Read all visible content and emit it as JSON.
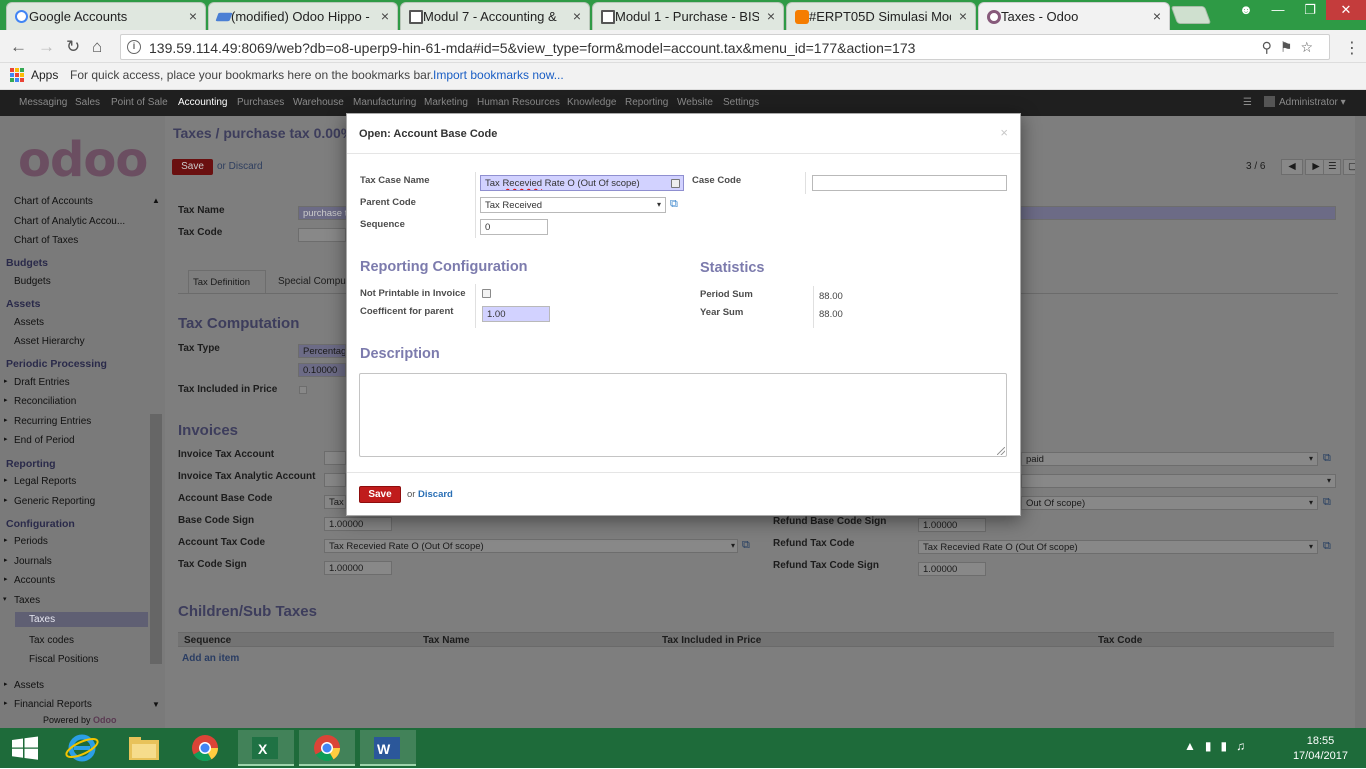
{
  "browser": {
    "tabs": [
      {
        "label": "Google Accounts",
        "favicon": "google-g-icon",
        "color": "#4285f4"
      },
      {
        "label": "(modified) Odoo Hippo -",
        "favicon": "layers-icon",
        "color": "#4a7fd4"
      },
      {
        "label": "Modul 7 - Accounting &",
        "favicon": "book-icon",
        "color": "#555555"
      },
      {
        "label": "Modul 1 - Purchase - BIS",
        "favicon": "book-icon",
        "color": "#555555"
      },
      {
        "label": "#ERPT05D Simulasi Mod",
        "favicon": "blogger-icon",
        "color": "#f57d00"
      },
      {
        "label": "Taxes - Odoo",
        "favicon": "odoo-circle-icon",
        "color": "#875a7b"
      }
    ],
    "tab_close": "×",
    "url": "139.59.114.49:8069/web?db=o8-uperp9-hin-61-mda#id=5&view_type=form&model=account.tax&menu_id=177&action=173",
    "bookmarks": {
      "apps_label": "Apps",
      "hint": "For quick access, place your bookmarks here on the bookmarks bar.",
      "import_link": "Import bookmarks now..."
    }
  },
  "topmenu": {
    "items": [
      "Messaging",
      "Sales",
      "Point of Sale",
      "Accounting",
      "Purchases",
      "Warehouse",
      "Manufacturing",
      "Marketing",
      "Human Resources",
      "Knowledge",
      "Reporting",
      "Website",
      "Settings"
    ],
    "active": "Accounting",
    "user": "Administrator"
  },
  "sidebar": {
    "logo": "odoo",
    "entries": [
      {
        "label": "Chart of Accounts",
        "kind": "item"
      },
      {
        "label": "Chart of Analytic Accou...",
        "kind": "item"
      },
      {
        "label": "Chart of Taxes",
        "kind": "item"
      },
      {
        "label": "Budgets",
        "kind": "header"
      },
      {
        "label": "Budgets",
        "kind": "item"
      },
      {
        "label": "Assets",
        "kind": "header"
      },
      {
        "label": "Assets",
        "kind": "item"
      },
      {
        "label": "Asset Hierarchy",
        "kind": "item"
      },
      {
        "label": "Periodic Processing",
        "kind": "header"
      },
      {
        "label": "Draft Entries",
        "kind": "expand"
      },
      {
        "label": "Reconciliation",
        "kind": "expand"
      },
      {
        "label": "Recurring Entries",
        "kind": "expand"
      },
      {
        "label": "End of Period",
        "kind": "expand"
      },
      {
        "label": "Reporting",
        "kind": "header"
      },
      {
        "label": "Legal Reports",
        "kind": "expand"
      },
      {
        "label": "Generic Reporting",
        "kind": "expand"
      },
      {
        "label": "Configuration",
        "kind": "header"
      },
      {
        "label": "Periods",
        "kind": "expand"
      },
      {
        "label": "Journals",
        "kind": "expand"
      },
      {
        "label": "Accounts",
        "kind": "expand"
      },
      {
        "label": "Taxes",
        "kind": "open"
      },
      {
        "label": "Taxes",
        "kind": "selected"
      },
      {
        "label": "Tax codes",
        "kind": "sub"
      },
      {
        "label": "Fiscal Positions",
        "kind": "sub"
      },
      {
        "label": "Assets",
        "kind": "expand"
      },
      {
        "label": "Financial Reports",
        "kind": "expand"
      }
    ],
    "powered_by": "Powered by",
    "powered_brand": "Odoo"
  },
  "background_form": {
    "breadcrumb": "Taxes / purchase tax 0.00%",
    "save": "Save",
    "or_discard": "or Discard",
    "pager": "3 / 6",
    "tax_name_label": "Tax Name",
    "tax_name_value": "purchase t",
    "tax_code_label": "Tax Code",
    "tab_definition": "Tax Definition",
    "tab_special": "Special Comput",
    "section_computation": "Tax Computation",
    "tax_type_label": "Tax Type",
    "tax_type_value": "Percentag",
    "amount_value": "0.10000",
    "tax_included_label": "Tax Included in Price",
    "section_invoices": "Invoices",
    "invoice_tax_account": "Invoice Tax Account",
    "invoice_tax_analytic": "Invoice Tax Analytic Account",
    "account_base_code": "Account Base Code",
    "account_base_code_value": "Tax",
    "base_code_sign": "Base Code Sign",
    "base_code_sign_value": "1.00000",
    "account_tax_code": "Account Tax Code",
    "account_tax_code_value": "Tax Recevied Rate O (Out Of scope)",
    "tax_code_sign": "Tax Code Sign",
    "tax_code_sign_value": "1.00000",
    "right_paid": "paid",
    "right_base": "Out Of scope)",
    "refund_base_code_sign": "Refund Base Code Sign",
    "refund_base_code_sign_value": "1.00000",
    "refund_tax_code": "Refund Tax Code",
    "refund_tax_code_value": "Tax Recevied Rate O (Out Of scope)",
    "refund_tax_code_sign": "Refund Tax Code Sign",
    "refund_tax_code_sign_value": "1.00000",
    "section_children": "Children/Sub Taxes",
    "columns": [
      "Sequence",
      "Tax Name",
      "Tax Included in Price",
      "Tax Code"
    ],
    "add_item": "Add an item"
  },
  "modal": {
    "title": "Open: Account Base Code",
    "close": "×",
    "tax_case_name_label": "Tax Case Name",
    "tax_case_name_value": "Tax Recevied Rate O (Out Of scope)",
    "tax_case_name_misspelled": "Recevied",
    "parent_code_label": "Parent Code",
    "parent_code_value": "Tax Received",
    "sequence_label": "Sequence",
    "sequence_value": "0",
    "case_code_label": "Case Code",
    "case_code_value": "",
    "reporting_section": "Reporting Configuration",
    "not_printable_label": "Not Printable in Invoice",
    "not_printable_checked": false,
    "coefficient_label": "Coefficent for parent",
    "coefficient_value": "1.00",
    "statistics_section": "Statistics",
    "period_sum_label": "Period Sum",
    "period_sum_value": "88.00",
    "year_sum_label": "Year Sum",
    "year_sum_value": "88.00",
    "description_section": "Description",
    "description_value": "",
    "save_label": "Save",
    "or_label": "or",
    "discard_label": "Discard"
  },
  "taskbar": {
    "time": "18:55",
    "date": "17/04/2017",
    "apps": [
      "windows-start-icon",
      "internet-explorer-icon",
      "file-explorer-icon",
      "chrome-icon",
      "excel-icon",
      "chrome-icon",
      "word-icon"
    ]
  },
  "colors": {
    "accent_purple": "#7c7bad",
    "save_red": "#c01c1c",
    "link_blue": "#2a6fb5",
    "field_focus": "#d2d2ff",
    "chrome_green": "#2e9a45",
    "taskbar_green": "#1e6b3a"
  }
}
